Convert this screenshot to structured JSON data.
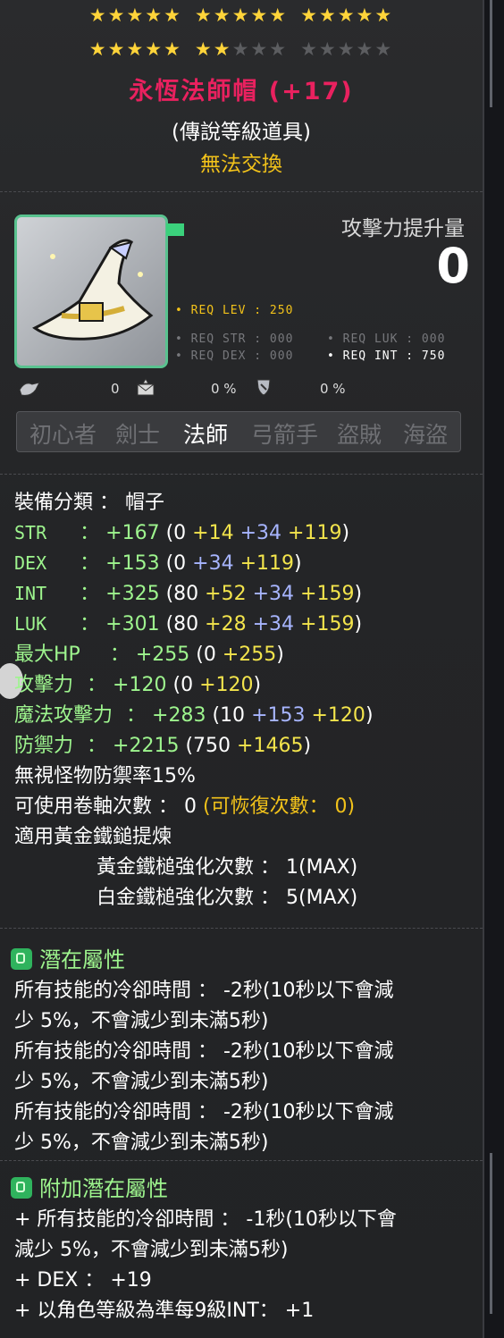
{
  "stars": {
    "row1": [
      "on",
      "on",
      "on",
      "on",
      "on",
      "gap",
      "on",
      "on",
      "on",
      "on",
      "on",
      "gap",
      "on",
      "on",
      "on",
      "on",
      "on"
    ],
    "row2": [
      "on",
      "on",
      "on",
      "on",
      "on",
      "gap",
      "on",
      "on",
      "off",
      "off",
      "off",
      "gap",
      "off",
      "off",
      "off",
      "off",
      "off"
    ]
  },
  "item": {
    "name": "永恆法師帽 (+17)",
    "grade": "(傳說等級道具)",
    "trade": "無法交換",
    "atk_increase_label": "攻擊力提升量",
    "atk_increase_value": "0",
    "icon": "witch-hat-icon"
  },
  "requirements": {
    "lev": "• REQ LEV : 250",
    "str": "• REQ STR : 000",
    "luk": "• REQ LUK : 000",
    "dex": "• REQ DEX : 000",
    "int": "• REQ INT : 750"
  },
  "info_row": {
    "a": "0",
    "b": "0 %",
    "c": "0 %"
  },
  "jobs": [
    "初心者",
    "劍士",
    "法師",
    "弓箭手",
    "盜賊",
    "海盜"
  ],
  "stats": {
    "category_label": "裝備分類 ： 帽子",
    "str": {
      "label": "STR",
      "sep": "：",
      "total": "+167",
      "open": "(",
      "base": "0",
      "a": "+14",
      "b": "+34",
      "c": "+119",
      "close": ")"
    },
    "dex": {
      "label": "DEX",
      "sep": "：",
      "total": "+153",
      "open": "(",
      "base": "0",
      "b": "+34",
      "c": "+119",
      "close": ")"
    },
    "int": {
      "label": "INT",
      "sep": "：",
      "total": "+325",
      "open": "(",
      "base": "80",
      "a": "+52",
      "b": "+34",
      "c": "+159",
      "close": ")"
    },
    "luk": {
      "label": "LUK",
      "sep": "：",
      "total": "+301",
      "open": "(",
      "base": "80",
      "a": "+28",
      "b": "+34",
      "c": "+159",
      "close": ")"
    },
    "hp": {
      "label": "最大HP",
      "sep": "：",
      "total": "+255",
      "open": "(",
      "base": "0",
      "c": "+255",
      "close": ")"
    },
    "atk": {
      "label": "攻擊力",
      "sep": "：",
      "total": "+120",
      "open": "(",
      "base": "0",
      "c": "+120",
      "close": ")"
    },
    "matk": {
      "label": "魔法攻擊力",
      "sep": "：",
      "total": "+283",
      "open": "(",
      "base": "10",
      "a": "+153",
      "c": "+120",
      "close": ")"
    },
    "def": {
      "label": "防禦力",
      "sep": "：",
      "total": "+2215",
      "open": "(",
      "base": "750",
      "a": "+1465",
      "close": ")"
    },
    "ignore_def": "無視怪物防禦率15%",
    "scroll_label": "可使用卷軸次數 ： 0",
    "scroll_restore": "(可恢復次數： 0)",
    "hammer_title": "適用黃金鐵鎚提煉",
    "gold_hammer": "黃金鐵槌強化次數 ： 1(MAX)",
    "platinum_hammer": "白金鐵槌強化次數 ： 5(MAX)"
  },
  "potential": {
    "title": "潛在屬性",
    "lines": [
      "所有技能的冷卻時間 ： -2秒(10秒以下會減",
      "少 5%，不會減少到未滿5秒)",
      "所有技能的冷卻時間 ： -2秒(10秒以下會減",
      "少 5%，不會減少到未滿5秒)",
      "所有技能的冷卻時間 ： -2秒(10秒以下會減",
      "少 5%，不會減少到未滿5秒)"
    ]
  },
  "additional_potential": {
    "title": "附加潛在屬性",
    "lines": [
      "+ 所有技能的冷卻時間 ： -1秒(10秒以下會",
      "減少 5%，不會減少到未滿5秒)",
      "+ DEX ： +19",
      "+ 以角色等級為準每9級INT： +1"
    ]
  },
  "colors": {
    "title": "#e9215f",
    "gold": "#f2c21a",
    "green": "#9ef58e",
    "blue": "#a7b5ff",
    "yellow": "#f3e44c"
  }
}
